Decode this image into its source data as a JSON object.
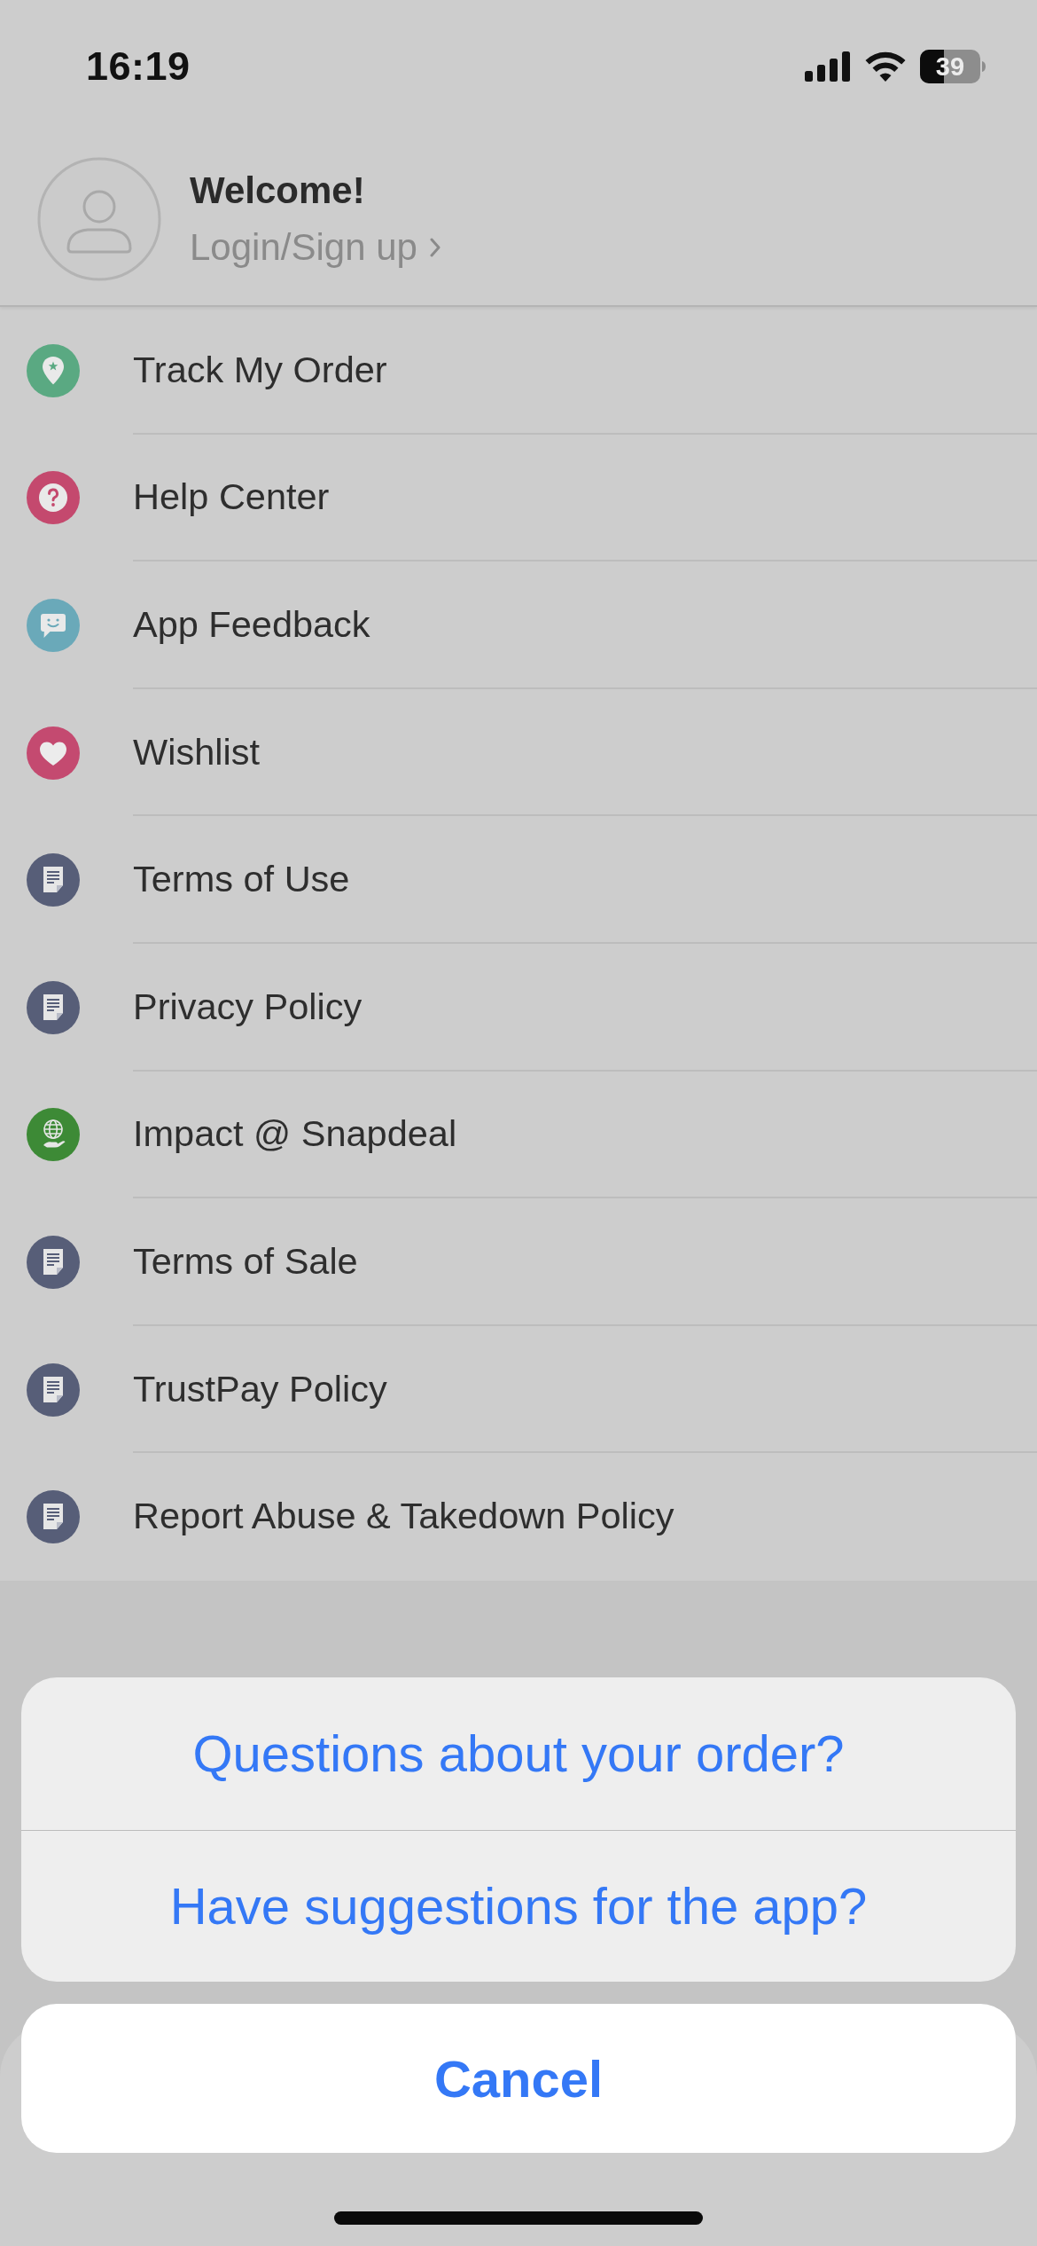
{
  "status_bar": {
    "time": "16:19",
    "battery": "39"
  },
  "header": {
    "greeting": "Welcome!",
    "login_link": "Login/Sign up"
  },
  "menu": [
    {
      "label": "Track My Order",
      "kind": "pin",
      "color": "#5aa982"
    },
    {
      "label": "Help Center",
      "kind": "help",
      "color": "#c4496e"
    },
    {
      "label": "App Feedback",
      "kind": "feedback",
      "color": "#6aa9b9"
    },
    {
      "label": "Wishlist",
      "kind": "heart",
      "color": "#c44a70"
    },
    {
      "label": "Terms of Use",
      "kind": "document",
      "color": "#575e78"
    },
    {
      "label": "Privacy Policy",
      "kind": "document",
      "color": "#575e78"
    },
    {
      "label": "Impact @ Snapdeal",
      "kind": "globe",
      "color": "#3d8a36"
    },
    {
      "label": "Terms of Sale",
      "kind": "document",
      "color": "#575e78"
    },
    {
      "label": "TrustPay Policy",
      "kind": "document",
      "color": "#575e78"
    },
    {
      "label": "Report Abuse & Takedown Policy",
      "kind": "document",
      "color": "#575e78"
    }
  ],
  "action_sheet": {
    "options": [
      "Questions about your order?",
      "Have suggestions for the app?"
    ],
    "cancel": "Cancel"
  }
}
